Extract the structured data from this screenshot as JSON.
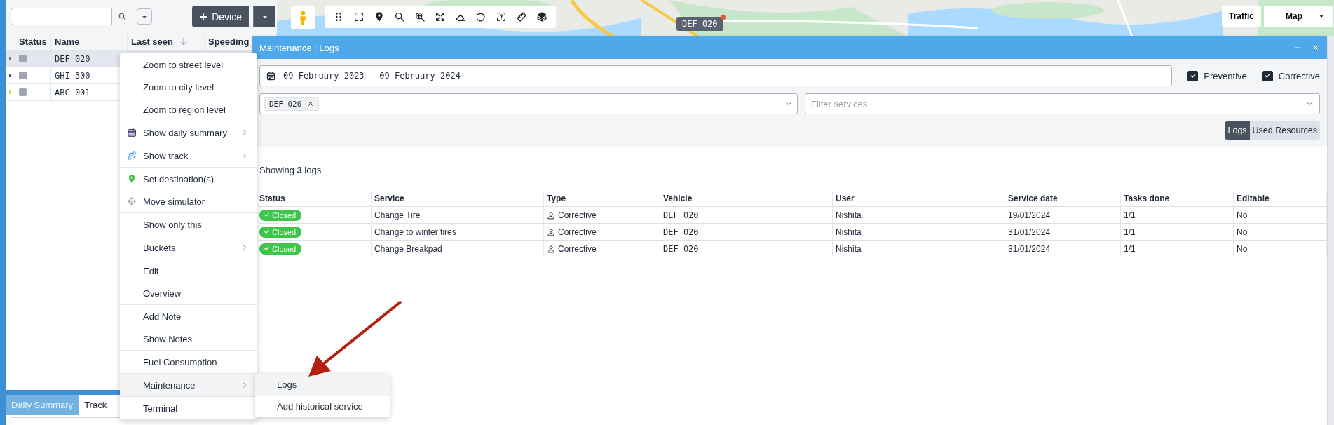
{
  "sidebar": {
    "add_button": "Device"
  },
  "device_table": {
    "columns": [
      "Status",
      "Name",
      "Last seen",
      "Speeding"
    ],
    "rows": [
      {
        "name": "DEF 020",
        "color": "#6b7785",
        "selected": true
      },
      {
        "name": "GHI 300",
        "color": "#3f4bb5",
        "selected": false
      },
      {
        "name": "ABC 001",
        "color": "#cddc39",
        "selected": false
      }
    ]
  },
  "bottom_tabs": [
    {
      "label": "Daily Summary",
      "selected": true
    },
    {
      "label": "Track",
      "selected": false
    }
  ],
  "map": {
    "marker_label": "DEF 020",
    "traffic_button": "Traffic",
    "map_type": "Map"
  },
  "dialog": {
    "title": "Maintenance : Logs",
    "date_range": "09 February 2023 - 09 February 2024",
    "checkboxes": [
      {
        "label": "Preventive",
        "checked": true
      },
      {
        "label": "Corrective",
        "checked": true
      }
    ],
    "vehicle_tags": [
      "DEF 020"
    ],
    "service_filter": {
      "placeholder": "Filter services"
    },
    "view_tabs": [
      {
        "label": "Logs",
        "selected": true
      },
      {
        "label": "Used Resources",
        "selected": false
      }
    ],
    "summary": "Showing **3** logs",
    "table": {
      "columns": [
        "Status",
        "Service",
        "Type",
        "Vehicle",
        "User",
        "Service date",
        "Tasks done",
        "Editable"
      ],
      "rows": [
        {
          "status": "Closed",
          "service": "Change Tire",
          "type": "Corrective",
          "vehicle": "DEF 020",
          "user": "Nishita",
          "service_date": "19/01/2024",
          "tasks_done": "1/1",
          "editable": "No"
        },
        {
          "status": "Closed",
          "service": "Change to winter tires",
          "type": "Corrective",
          "vehicle": "DEF 020",
          "user": "Nishita",
          "service_date": "31/01/2024",
          "tasks_done": "1/1",
          "editable": "No"
        },
        {
          "status": "Closed",
          "service": "Change Breakpad",
          "type": "Corrective",
          "vehicle": "DEF 020",
          "user": "Nishita",
          "service_date": "31/01/2024",
          "tasks_done": "1/1",
          "editable": "No"
        }
      ]
    }
  },
  "context_menu": {
    "groups": [
      [
        {
          "label": "Zoom to street level",
          "kind": "plain",
          "submenu": false,
          "expanded": false
        },
        {
          "label": "Zoom to city level",
          "kind": "plain",
          "submenu": false,
          "expanded": false
        },
        {
          "label": "Zoom to region level",
          "kind": "plain",
          "submenu": false,
          "expanded": false
        }
      ],
      [
        {
          "label": "Show daily summary",
          "kind": "calendar",
          "submenu": true,
          "expanded": false
        }
      ],
      [
        {
          "label": "Show track",
          "kind": "track",
          "submenu": true,
          "expanded": false
        }
      ],
      [
        {
          "label": "Set destination(s)",
          "kind": "pin",
          "submenu": false,
          "expanded": false
        },
        {
          "label": "Move simulator",
          "kind": "move",
          "submenu": false,
          "expanded": false
        }
      ],
      [
        {
          "label": "Show only this",
          "kind": "plain",
          "submenu": false,
          "expanded": false
        }
      ],
      [
        {
          "label": "Buckets",
          "kind": "plain",
          "submenu": true,
          "expanded": false
        }
      ],
      [
        {
          "label": "Edit",
          "kind": "plain",
          "submenu": false,
          "expanded": false
        },
        {
          "label": "Overview",
          "kind": "plain",
          "submenu": false,
          "expanded": false
        }
      ],
      [
        {
          "label": "Add Note",
          "kind": "plain",
          "submenu": false,
          "expanded": false
        },
        {
          "label": "Show Notes",
          "kind": "plain",
          "submenu": false,
          "expanded": false
        }
      ],
      [
        {
          "label": "Fuel Consumption",
          "kind": "plain",
          "submenu": false,
          "expanded": false
        }
      ],
      [
        {
          "label": "Maintenance",
          "kind": "plain",
          "submenu": true,
          "expanded": true
        }
      ],
      [
        {
          "label": "Terminal",
          "kind": "plain",
          "submenu": false,
          "expanded": false
        }
      ]
    ]
  },
  "submenu": {
    "items": [
      {
        "label": "Logs",
        "selected": true
      },
      {
        "label": "Add historical service",
        "selected": false
      }
    ]
  }
}
